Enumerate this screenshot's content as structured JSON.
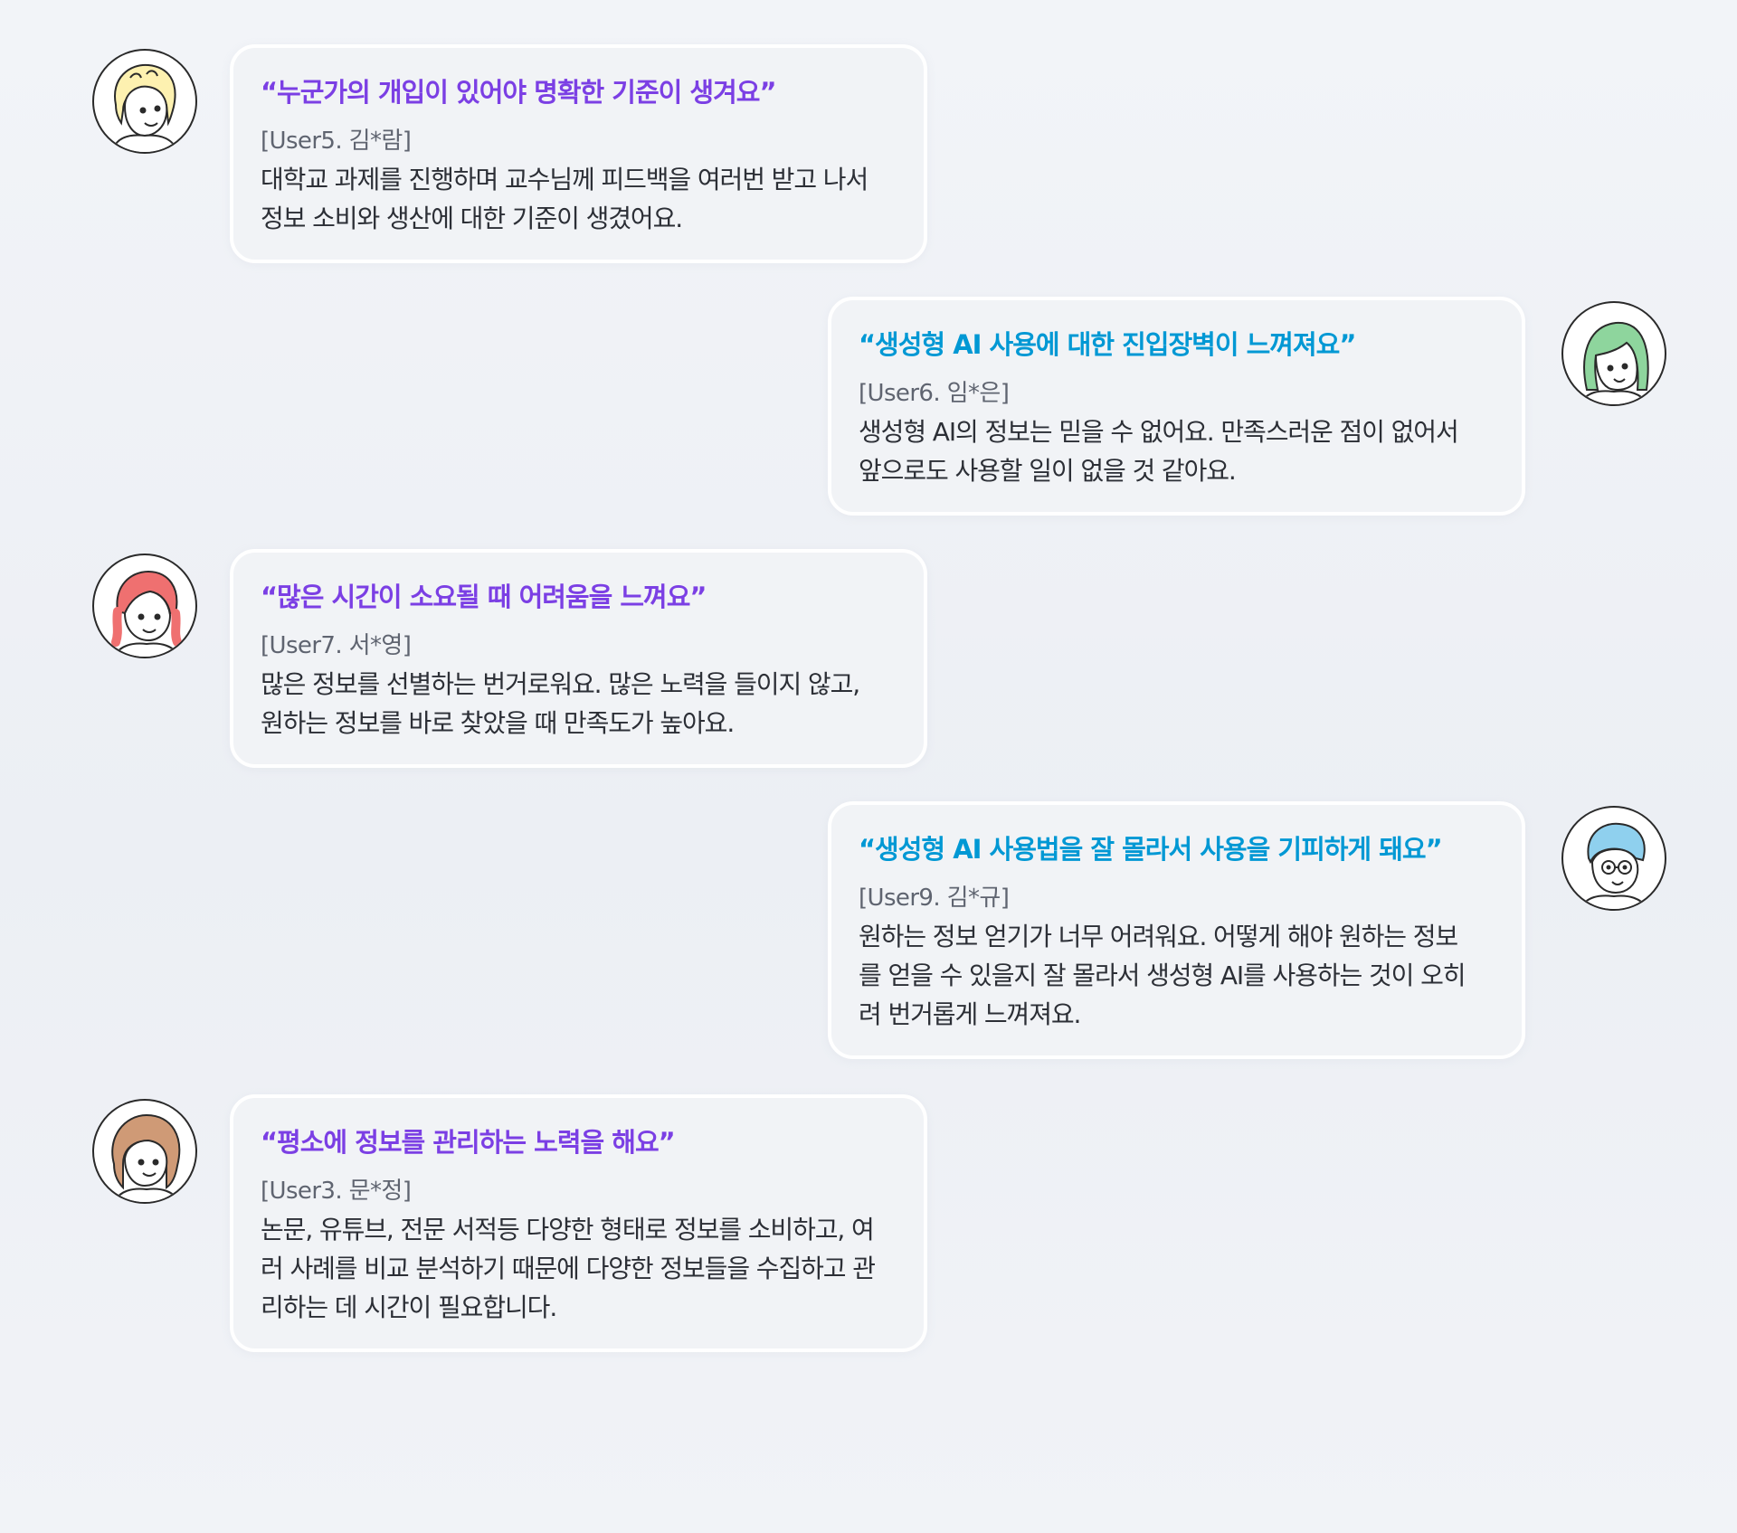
{
  "testimonials": [
    {
      "headline": "“누군가의 개입이 있어야 명확한 기준이 생겨요”",
      "user": "[User5. 김*람]",
      "lines": [
        "대학교 과제를 진행하며 교수님께 피드백을 여러번 받고 나서",
        "정보 소비와 생산에 대한 기준이 생겼어요."
      ],
      "avatar": "avatar-yellow-hair-icon"
    },
    {
      "headline": "“생성형 AI 사용에 대한 진입장벽이 느껴져요”",
      "user": "[User6. 임*은]",
      "lines": [
        "생성형 AI의 정보는 믿을 수 없어요. 만족스러운 점이 없어서",
        "앞으로도 사용할 일이 없을 것 같아요."
      ],
      "avatar": "avatar-green-hair-icon"
    },
    {
      "headline": "“많은 시간이 소요될 때 어려움을 느껴요”",
      "user": "[User7. 서*영]",
      "lines": [
        "많은 정보를 선별하는 번거로워요. 많은 노력을 들이지 않고,",
        "원하는 정보를 바로 찾았을 때 만족도가 높아요."
      ],
      "avatar": "avatar-red-braids-icon"
    },
    {
      "headline": "“생성형 AI 사용법을 잘 몰라서 사용을 기피하게 돼요”",
      "user": "[User9. 김*규]",
      "lines": [
        "원하는 정보 얻기가 너무 어려워요. 어떻게 해야 원하는 정보",
        "를 얻을 수 있을지 잘 몰라서 생성형 AI를 사용하는 것이 오히",
        "려 번거롭게 느껴져요."
      ],
      "avatar": "avatar-blue-hair-glasses-icon"
    },
    {
      "headline": "“평소에 정보를 관리하는 노력을 해요”",
      "user": "[User3. 문*정]",
      "lines": [
        "논문, 유튜브, 전문 서적등 다양한 형태로 정보를 소비하고, 여",
        "러 사례를 비교 분석하기 때문에 다양한 정보들을 수집하고 관",
        "리하는 데 시간이 필요합니다."
      ],
      "avatar": "avatar-brown-curly-hair-icon"
    }
  ],
  "colors": {
    "purple_accent": "#7b3fe4",
    "blue_accent": "#0098d4",
    "yellow_hair": "#fdf1b0",
    "green_hair": "#8ed59d",
    "red_hair": "#ef7070",
    "blue_hair": "#8fd0ee",
    "brown_hair": "#cf9a76"
  }
}
